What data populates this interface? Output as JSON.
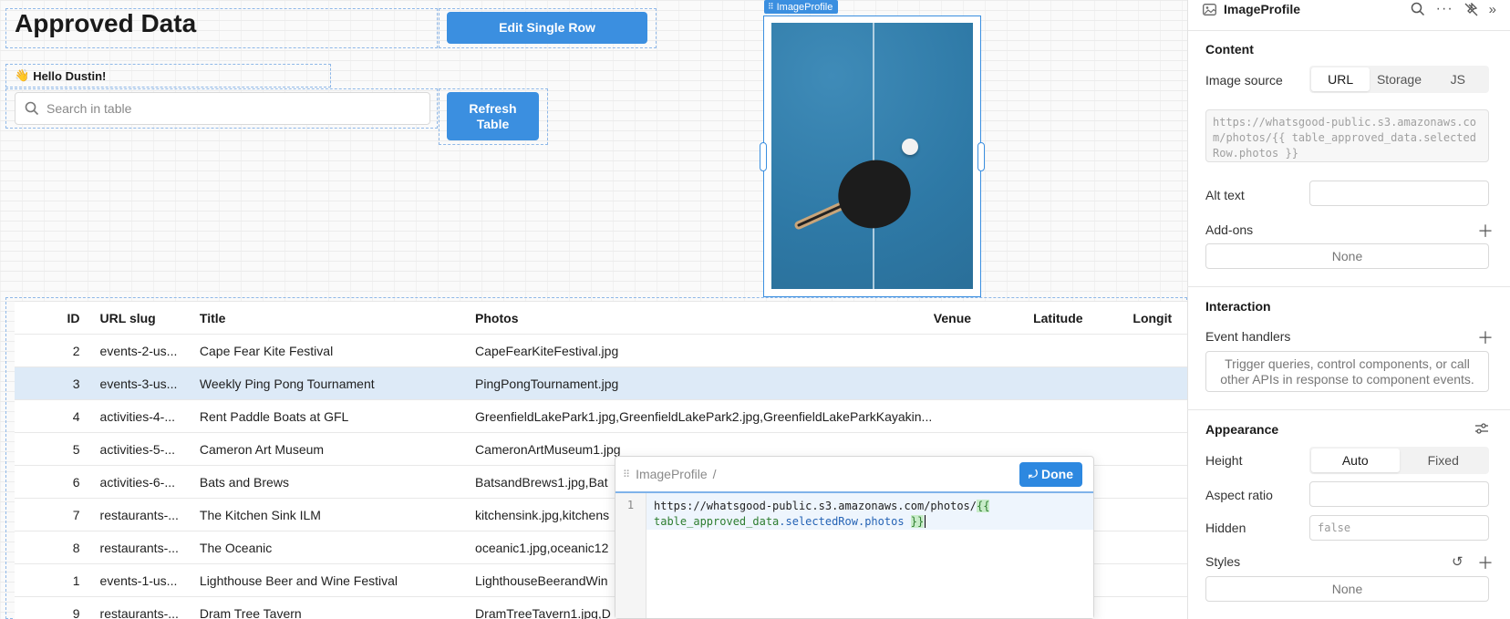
{
  "canvas": {
    "title": "Approved Data",
    "edit_button": "Edit Single Row",
    "greeting_emoji": "👋",
    "greeting": "Hello Dustin!",
    "search_placeholder": "Search in table",
    "refresh_button": "Refresh Table",
    "image_label": "ImageProfile"
  },
  "table": {
    "columns": [
      "ID",
      "URL slug",
      "Title",
      "Photos",
      "Venue",
      "Latitude",
      "Longit"
    ],
    "rows": [
      {
        "id": "2",
        "slug": "events-2-us...",
        "title": "Cape Fear Kite Festival",
        "photos": "CapeFearKiteFestival.jpg"
      },
      {
        "id": "3",
        "slug": "events-3-us...",
        "title": "Weekly Ping Pong Tournament",
        "photos": "PingPongTournament.jpg"
      },
      {
        "id": "4",
        "slug": "activities-4-...",
        "title": "Rent Paddle Boats at GFL",
        "photos": "GreenfieldLakePark1.jpg,GreenfieldLakePark2.jpg,GreenfieldLakeParkKayakin..."
      },
      {
        "id": "5",
        "slug": "activities-5-...",
        "title": "Cameron Art Museum",
        "photos": "CameronArtMuseum1.jpg"
      },
      {
        "id": "6",
        "slug": "activities-6-...",
        "title": "Bats and Brews",
        "photos": "BatsandBrews1.jpg,Bat"
      },
      {
        "id": "7",
        "slug": "restaurants-...",
        "title": "The Kitchen Sink ILM",
        "photos": "kitchensink.jpg,kitchens"
      },
      {
        "id": "8",
        "slug": "restaurants-...",
        "title": "The Oceanic",
        "photos": "oceanic1.jpg,oceanic12"
      },
      {
        "id": "1",
        "slug": "events-1-us...",
        "title": "Lighthouse Beer and Wine Festival",
        "photos": "LighthouseBeerandWin"
      },
      {
        "id": "9",
        "slug": "restaurants-...",
        "title": "Dram Tree Tavern",
        "photos": "DramTreeTavern1.jpg,D"
      }
    ],
    "selected_row_index": 1
  },
  "popover": {
    "title": "ImageProfile",
    "separator": "/",
    "done_label": "Done",
    "line_number": "1",
    "code_prefix": "https://whatsgood-public.s3.amazonaws.com/photos/",
    "code_open": "{{",
    "code_var": "table_approved_data",
    "code_prop": ".selectedRow.photos",
    "code_close": "}}"
  },
  "panel": {
    "component_name": "ImageProfile",
    "content_section": "Content",
    "image_source_label": "Image source",
    "image_source_options": [
      "URL",
      "Storage",
      "JS"
    ],
    "image_source_selected": "URL",
    "url_value": "https://whatsgood-public.s3.amazonaws.com/photos/{{ table_approved_data.selectedRow.photos }}",
    "alt_text_label": "Alt text",
    "addons_label": "Add-ons",
    "addons_value": "None",
    "interaction_section": "Interaction",
    "event_handlers_label": "Event handlers",
    "event_handlers_hint": "Trigger queries, control components, or call other APIs in response to component events.",
    "appearance_section": "Appearance",
    "height_label": "Height",
    "height_options": [
      "Auto",
      "Fixed"
    ],
    "height_selected": "Auto",
    "aspect_ratio_label": "Aspect ratio",
    "hidden_label": "Hidden",
    "hidden_value": "false",
    "styles_label": "Styles",
    "styles_value": "None"
  },
  "colors": {
    "accent": "#3b8fe0",
    "selected_row": "#ddeaf7"
  }
}
